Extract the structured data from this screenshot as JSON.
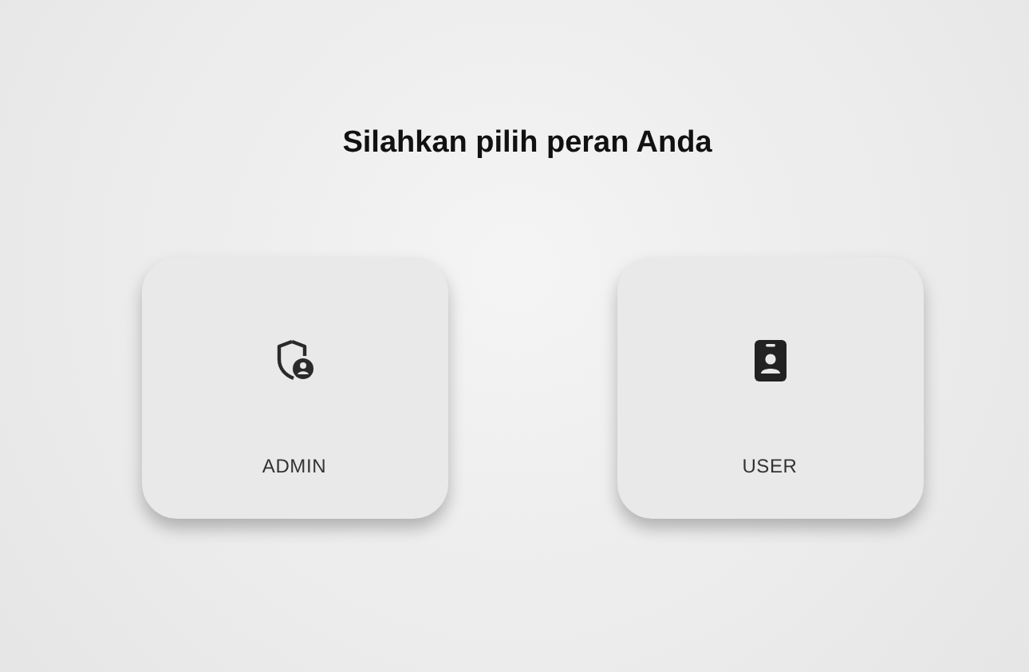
{
  "heading": "Silahkan pilih peran Anda",
  "roles": [
    {
      "label": "ADMIN",
      "kind": "shield"
    },
    {
      "label": "USER",
      "kind": "badge"
    }
  ]
}
